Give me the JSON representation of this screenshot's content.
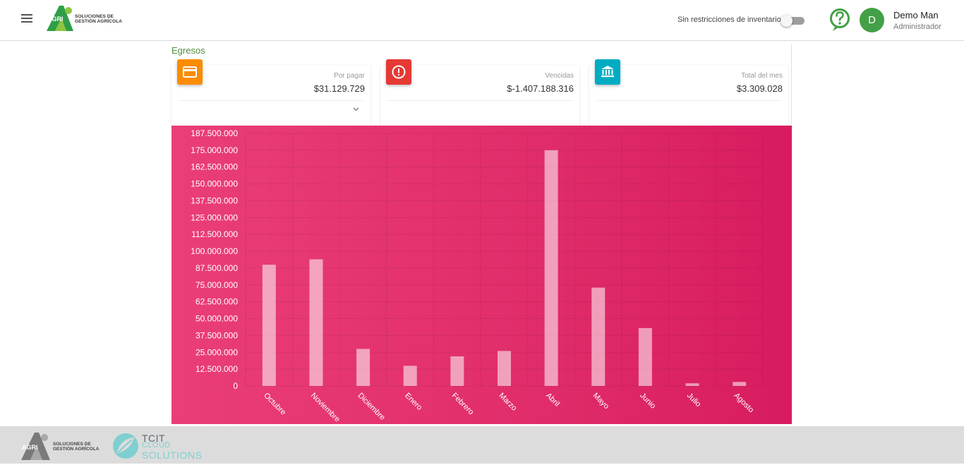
{
  "header": {
    "brand_line1": "SOLUCIONES DE",
    "brand_line2": "GESTIÓN AGRÍCOLA",
    "logo_mark": "AGRI",
    "inventory_toggle_label": "Sin restricciones de inventario",
    "inventory_toggle_on": false,
    "user": {
      "initial": "D",
      "name": "Demo Man",
      "role": "Administrador"
    }
  },
  "section": {
    "title": "Egresos"
  },
  "cards": [
    {
      "label": "Por pagar",
      "value": "$31.129.729",
      "icon": "credit-card-icon",
      "color": "#fb8c00"
    },
    {
      "label": "Vencidas",
      "value": "$-1.407.188.316",
      "icon": "alert-circle-icon",
      "color": "#e53935"
    },
    {
      "label": "Total del mes",
      "value": "$3.309.028",
      "icon": "bank-icon",
      "color": "#00acc1"
    }
  ],
  "chart_data": {
    "type": "bar",
    "categories": [
      "Octubre",
      "Noviembre",
      "Diciembre",
      "Enero",
      "Febrero",
      "Marzo",
      "Abril",
      "Mayo",
      "Junio",
      "Julio",
      "Agosto"
    ],
    "values": [
      90000000,
      94000000,
      27500000,
      15000000,
      22000000,
      26000000,
      175000000,
      73000000,
      43000000,
      2000000,
      3000000
    ],
    "ylim": [
      0,
      187500000
    ],
    "yticks": [
      "0",
      "12.500.000",
      "25.000.000",
      "37.500.000",
      "50.000.000",
      "62.500.000",
      "75.000.000",
      "87.500.000",
      "100.000.000",
      "112.500.000",
      "125.000.000",
      "137.500.000",
      "150.000.000",
      "162.500.000",
      "175.000.000",
      "187.500.000"
    ],
    "grid": true,
    "title": "",
    "xlabel": "",
    "ylabel": ""
  },
  "footer": {
    "agri_line1": "SOLUCIONES DE",
    "agri_line2": "GESTIÓN AGRÍCOLA",
    "agri_mark": "AGRI",
    "tcit_line1": "TCIT",
    "tcit_line2": "CLOUD",
    "tcit_line3": "SOLUTIONS"
  }
}
